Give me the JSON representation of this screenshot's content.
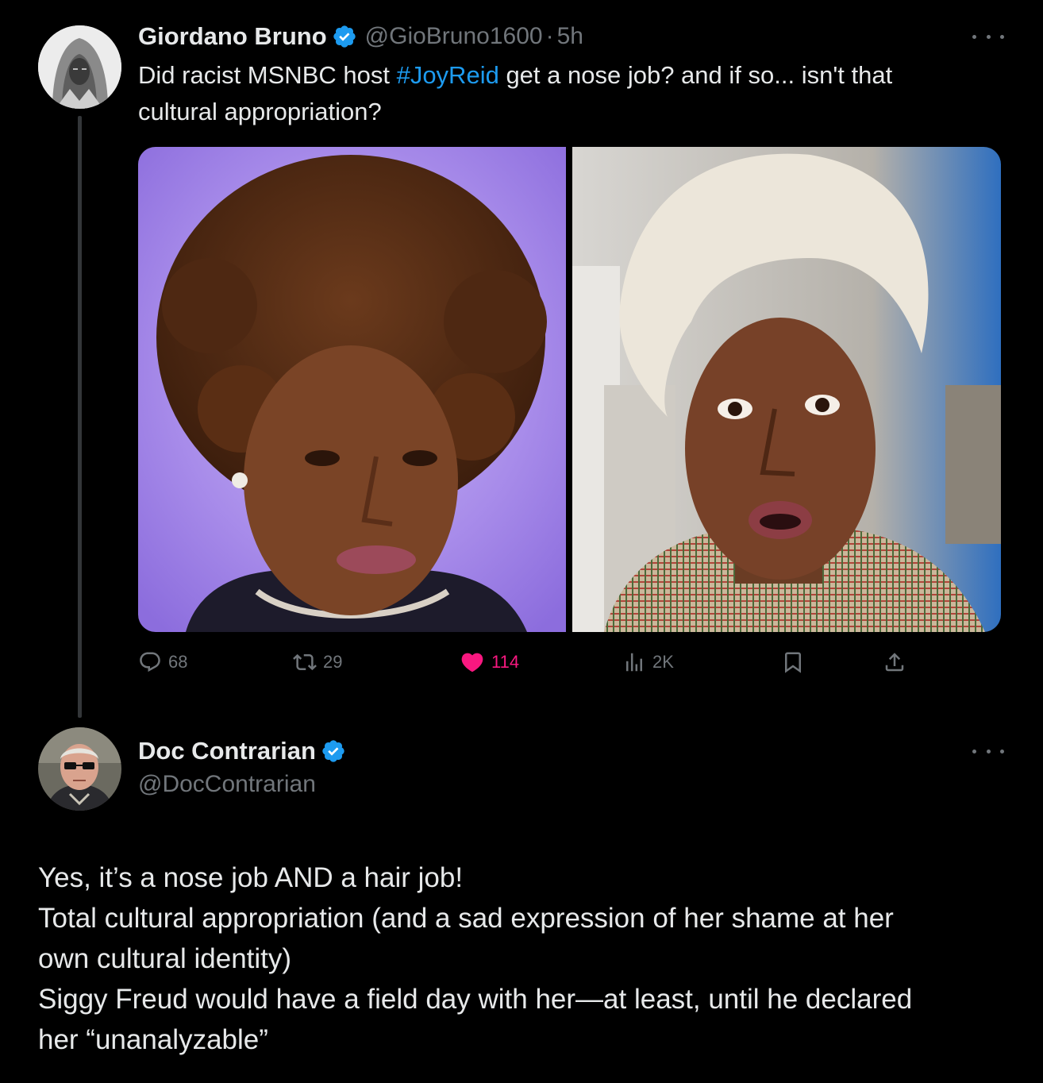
{
  "tweet1": {
    "display_name": "Giordano Bruno",
    "handle": "@GioBruno1600",
    "separator": "·",
    "time": "5h",
    "text_before": "Did racist MSNBC host ",
    "hashtag": "#JoyReid",
    "text_after_line1": " get a nose job? and if so... isn't that",
    "text_line2": "cultural appropriation?",
    "media": [
      "woman-curly-hair-portrait",
      "woman-platinum-hair-portrait"
    ],
    "actions": {
      "replies": "68",
      "reposts": "29",
      "likes": "114",
      "views": "2K"
    }
  },
  "tweet2": {
    "display_name": "Doc Contrarian",
    "handle": "@DocContrarian",
    "lines": [
      "Yes, it’s a nose job AND a hair job!",
      "Total cultural appropriation (and a sad expression of her shame at her",
      "own cultural identity)",
      "Siggy Freud would have a field day with her—at least, until he declared",
      "her “unanalyzable”"
    ]
  },
  "colors": {
    "background": "#000000",
    "text": "#e7e9ea",
    "muted": "#71767b",
    "link": "#1d9bf0",
    "like": "#f91880",
    "verified": "#1d9bf0"
  },
  "icons": [
    "verified-badge-icon",
    "more-icon",
    "reply-icon",
    "repost-icon",
    "like-icon",
    "views-icon",
    "bookmark-icon",
    "share-icon"
  ]
}
